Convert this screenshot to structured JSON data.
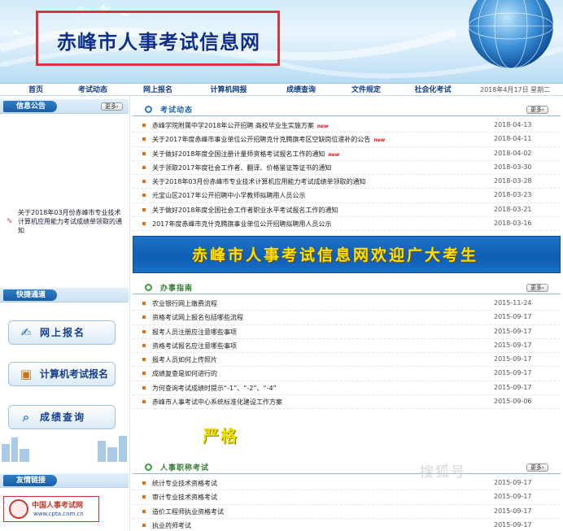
{
  "header": {
    "site_title": "赤峰市人事考试信息网"
  },
  "nav": {
    "items": [
      "首页",
      "考试动态",
      "网上报名",
      "计算机网报",
      "成绩查询",
      "文件规定",
      "社会化考试"
    ],
    "date": "2018年4月17日 星期二"
  },
  "sidebar": {
    "notice_title": "信息公告",
    "more_label": "更多",
    "notice_text": "关于2018年03月份赤峰市专业技术计算机应用能力考试成绩单领取的通知",
    "quick_title": "快捷通道",
    "buttons": [
      {
        "label": "网上报名",
        "icon": "pen-icon"
      },
      {
        "label": "计算机考试报名",
        "icon": "gift-icon"
      },
      {
        "label": "成绩查询",
        "icon": "search-icon"
      }
    ],
    "links_title": "友情链接",
    "cpta_cn": "中国人事考试网",
    "cpta_en": "www.cpta.com.cn"
  },
  "sections": {
    "exam_news": {
      "title": "考试动态",
      "more": "更多",
      "items": [
        {
          "title": "赤峰学院附属中学2018年公开招聘 高校毕业生实施方案",
          "date": "2018-04-13",
          "new": true
        },
        {
          "title": "关于2017年度赤峰市事业单位公开招聘克什克腾旗考区空缺岗位递补的公告",
          "date": "2018-04-11",
          "new": true
        },
        {
          "title": "关于做好2018年度全国注册计量师资格考试报名工作的通知",
          "date": "2018-04-02",
          "new": true
        },
        {
          "title": "关于领取2017年度社会工作者、翻译、价格鉴证等证书的通知",
          "date": "2018-03-30",
          "new": false
        },
        {
          "title": "关于2018年03月份赤峰市专业技术计算机应用能力考试成绩单领取的通知",
          "date": "2018-03-28",
          "new": false
        },
        {
          "title": "元宝山区2017年公开招聘中小学教师拟聘用人员公示",
          "date": "2018-03-23",
          "new": false
        },
        {
          "title": "关于做好2018年度全国社会工作者职业水平考试报名工作的通知",
          "date": "2018-03-21",
          "new": false
        },
        {
          "title": "2017年度赤峰市克什克腾旗事业单位公开招聘拟聘用人员公示",
          "date": "2018-03-16",
          "new": false
        }
      ]
    },
    "banner": {
      "text": "赤峰市人事考试信息网欢迎广大考生"
    },
    "guide": {
      "title": "办事指南",
      "more": "更多",
      "items": [
        {
          "title": "农业银行网上缴费流程",
          "date": "2015-11-24"
        },
        {
          "title": "资格考试网上报名包括哪些流程",
          "date": "2015-09-17"
        },
        {
          "title": "报考人员注册应注意哪些事项",
          "date": "2015-09-17"
        },
        {
          "title": "资格考试报名应注意哪些事项",
          "date": "2015-09-17"
        },
        {
          "title": "报考人员如何上传照片",
          "date": "2015-09-17"
        },
        {
          "title": "成绩复查是如何进行的",
          "date": "2015-09-17"
        },
        {
          "title": "为何查询考试成绩时提示“-1”、“-2”、“-4”",
          "date": "2015-09-17"
        },
        {
          "title": "赤峰市人事考试中心系统标准化建设工作方案",
          "date": "2015-09-06"
        }
      ]
    },
    "promo": {
      "text": "严格"
    },
    "title_exam": {
      "title": "人事职称考试",
      "more": "更多",
      "items": [
        {
          "title": "统计专业技术资格考试",
          "date": "2015-09-17"
        },
        {
          "title": "审计专业技术资格考试",
          "date": "2015-09-17"
        },
        {
          "title": "造价工程师执业资格考试",
          "date": "2015-09-17"
        },
        {
          "title": "执业药师考试",
          "date": "2015-09-17"
        }
      ]
    }
  },
  "watermark": "搜狐号"
}
